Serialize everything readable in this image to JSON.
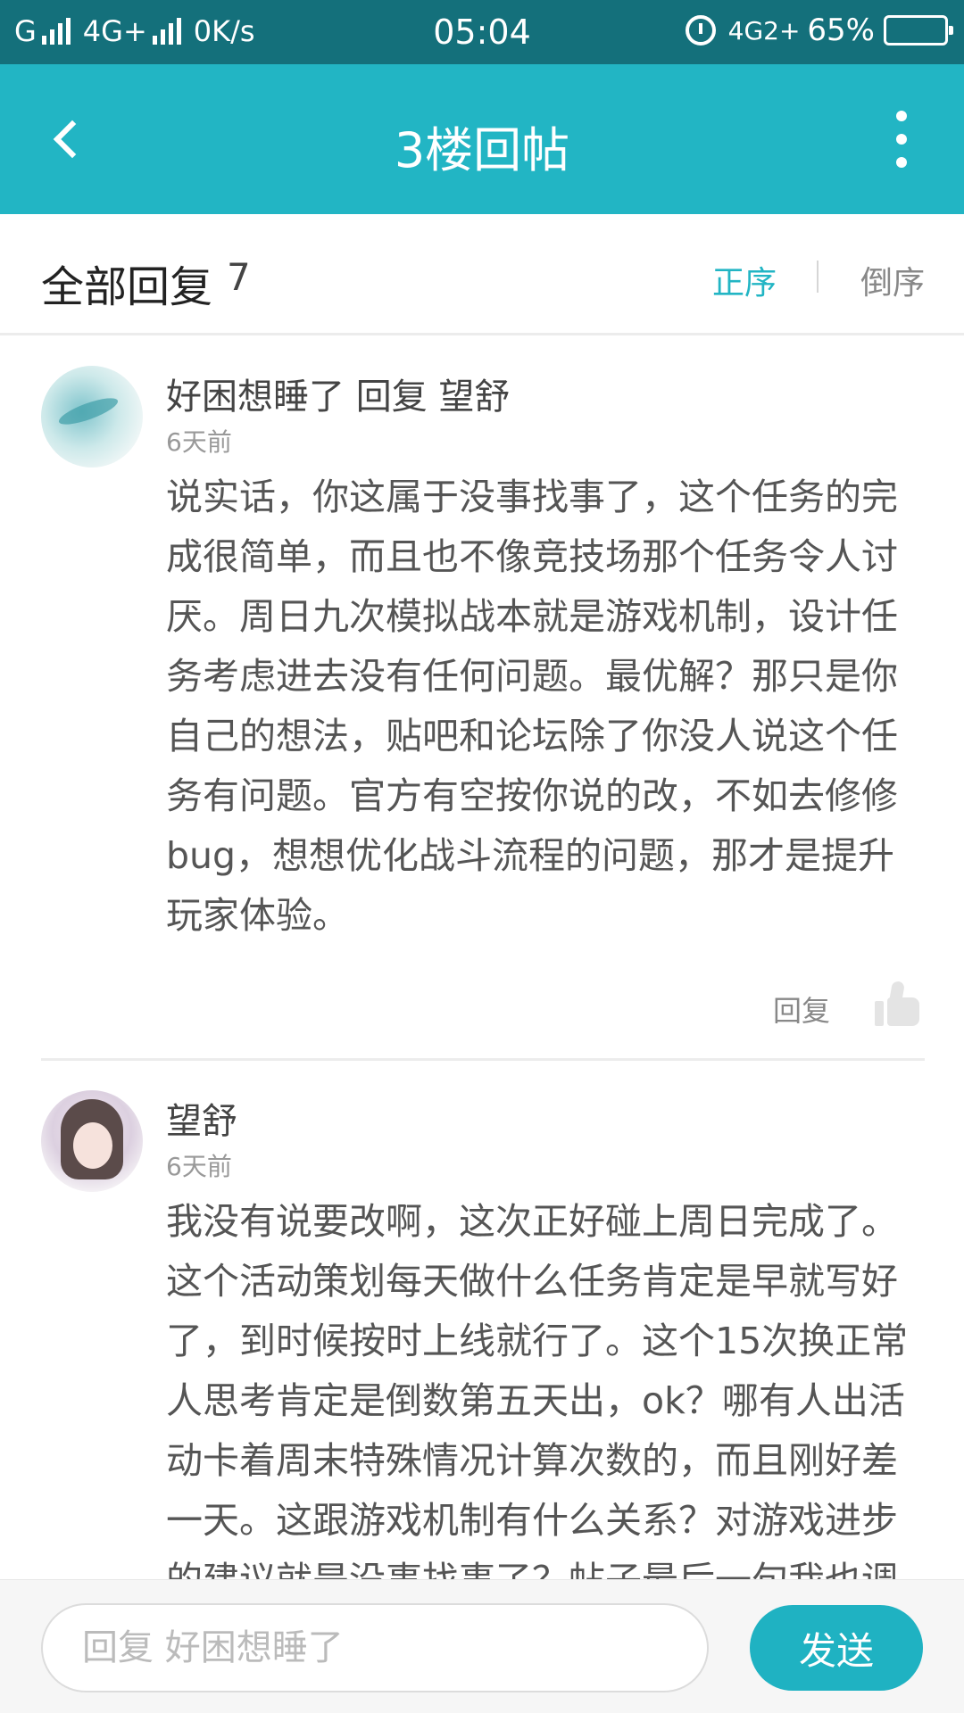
{
  "status_bar": {
    "carrier": "G",
    "network": "4G+",
    "speed": "0K/s",
    "time": "05:04",
    "network2": "4G2+",
    "battery": "65%",
    "battery_level": 0.65
  },
  "app_bar": {
    "title": "3楼回帖"
  },
  "reply_header": {
    "title": "全部回复",
    "count": "7",
    "sort_asc": "正序",
    "sort_desc": "倒序"
  },
  "comments": [
    {
      "author": "好困想睡了 回复 望舒",
      "time": "6天前",
      "body": "说实话，你这属于没事找事了，这个任务的完成很简单，而且也不像竞技场那个任务令人讨厌。周日九次模拟战本就是游戏机制，设计任务考虑进去没有任何问题。最优解？那只是你自己的想法，贴吧和论坛除了你没人说这个任务有问题。官方有空按你说的改，不如去修修bug，想想优化战斗流程的问题，那才是提升玩家体验。",
      "reply_label": "回复"
    },
    {
      "author": "望舒",
      "time": "6天前",
      "body": "我没有说要改啊，这次正好碰上周日完成了。这个活动策划每天做什么任务肯定是早就写好了，到时候按时上线就行了。这个15次换正常人思考肯定是倒数第五天出，ok？哪有人出活动卡着周末特殊情况计算次数的，而且刚好差一天。这跟游戏机制有什么关系？对游戏进步的建议就是没事找事了？帖子最后一句我也调"
    }
  ],
  "bottom_bar": {
    "placeholder": "回复 好困想睡了",
    "send_label": "发送"
  }
}
